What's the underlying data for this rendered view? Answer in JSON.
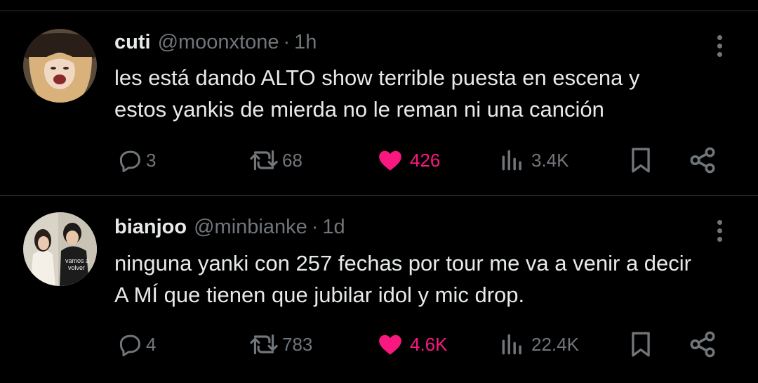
{
  "tweets": [
    {
      "name": "cuti",
      "handle": "@moonxtone",
      "separator": "·",
      "time": "1h",
      "text_lines": [
        "les está dando ALTO show terrible puesta en escena y",
        "estos yankis de mierda no le reman ni una canción"
      ],
      "replies": "3",
      "retweets": "68",
      "likes": "426",
      "views": "3.4K",
      "liked": true
    },
    {
      "name": "bianjoo",
      "handle": "@minbianke",
      "separator": "·",
      "time": "1d",
      "text_lines": [
        "ninguna yanki con 257 fechas por tour me va a venir a decir",
        "A MÍ que tienen que jubilar idol y mic drop."
      ],
      "avatar_photo_text": [
        "vamos a",
        "volver"
      ],
      "replies": "4",
      "retweets": "783",
      "likes": "4.6K",
      "views": "22.4K",
      "liked": true
    }
  ],
  "colors": {
    "background": "#000000",
    "text": "#e7e9ea",
    "muted": "#71767b",
    "like": "#f91880",
    "divider": "#2f3336"
  },
  "icons": [
    "reply-icon",
    "retweet-icon",
    "heart-icon",
    "views-icon",
    "bookmark-icon",
    "share-icon",
    "more-icon"
  ]
}
